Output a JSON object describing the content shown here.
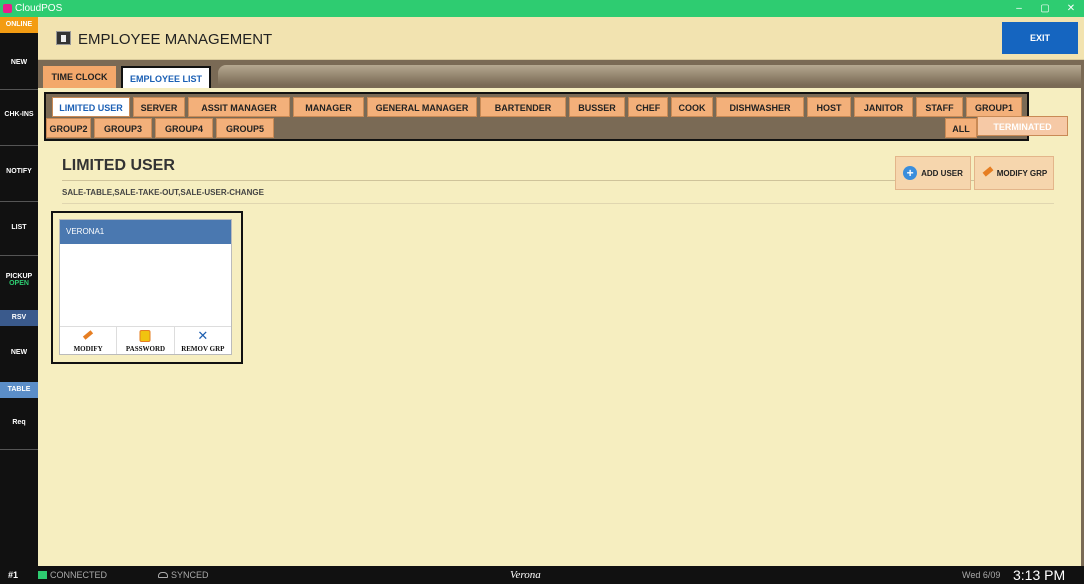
{
  "window": {
    "title": "CloudPOS",
    "minimize": "–",
    "restore": "▢",
    "close": "✕"
  },
  "sidebar": {
    "online": "ONLINE",
    "items": [
      {
        "label": "NEW"
      },
      {
        "label": "CHK-INS"
      },
      {
        "label": "NOTIFY"
      },
      {
        "label": "LIST"
      },
      {
        "label": "PICKUP",
        "sub": "OPEN"
      },
      {
        "label": "RSV"
      },
      {
        "label": "NEW"
      },
      {
        "label": "TABLE"
      },
      {
        "label": "Req"
      }
    ]
  },
  "header": {
    "title": "EMPLOYEE MANAGEMENT",
    "exit": "EXIT",
    "icon": "employee-icon"
  },
  "tabs": [
    {
      "label": "TIME CLOCK",
      "active": false
    },
    {
      "label": "EMPLOYEE LIST",
      "active": true
    }
  ],
  "groups": {
    "row1": [
      "LIMITED USER",
      "SERVER",
      "ASSIT MANAGER",
      "MANAGER",
      "GENERAL MANAGER",
      "BARTENDER",
      "BUSSER",
      "CHEF",
      "COOK",
      "DISHWASHER",
      "HOST",
      "JANITOR",
      "STAFF",
      "GROUP1"
    ],
    "row2": [
      "GROUP2",
      "GROUP3",
      "GROUP4",
      "GROUP5"
    ],
    "all": "ALL",
    "terminated": "TERMINATED",
    "selected": "LIMITED USER"
  },
  "section": {
    "title": "LIMITED USER",
    "permissions": "SALE-TABLE,SALE-TAKE-OUT,SALE-USER-CHANGE",
    "add_user": "ADD USER",
    "modify_grp": "MODIFY GRP"
  },
  "users": [
    {
      "name": "VERONA1",
      "modify": "MODIFY",
      "password": "PASSWORD",
      "remove": "REMOV GRP"
    }
  ],
  "status": {
    "terminal": "#1",
    "connection": "CONNECTED",
    "sync": "SYNCED",
    "store": "Verona",
    "date": "Wed 6/09",
    "time": "3:13 PM"
  },
  "colors": {
    "accent": "#1565c0",
    "tab": "#f3b07a",
    "title_bar": "#2ecc71"
  }
}
